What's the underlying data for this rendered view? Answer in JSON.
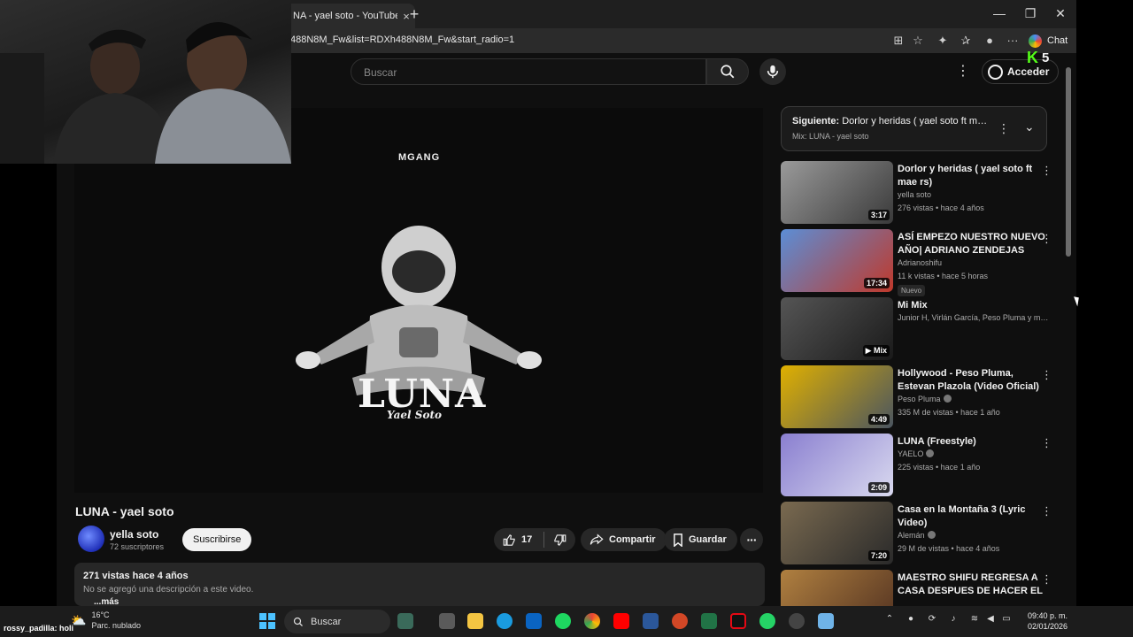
{
  "browser": {
    "tab_title": "NA - yael soto - YouTube",
    "tab_close": "×",
    "new_tab": "+",
    "url": "488N8M_Fw&list=RDXh488N8M_Fw&start_radio=1",
    "chat_label": "Chat",
    "win_minimize": "—",
    "win_maximize": "❐",
    "win_close": "✕"
  },
  "masthead": {
    "search_placeholder": "Buscar",
    "signin_label": "Acceder"
  },
  "video": {
    "brand": "MGANG",
    "art_title": "LUNA",
    "art_subtitle": "Yael Soto",
    "title": "LUNA - yael soto",
    "channel": "yella  soto",
    "subscribers": "72 suscriptores",
    "subscribe_label": "Suscribirse",
    "likes": "17",
    "share_label": "Compartir",
    "save_label": "Guardar",
    "more_label": "···",
    "stats": "271 vistas  hace 4 años",
    "description": "No se agregó una descripción a este video.",
    "more_text": "...más"
  },
  "mix": {
    "next_prefix": "Siguiente:",
    "next_title": "Dorlor y heridas ( yael soto ft mae ...",
    "subtitle": "Mix: LUNA - yael soto"
  },
  "playlist": [
    {
      "title": "Dorlor y heridas ( yael soto ft mae rs)",
      "channel": "yella soto",
      "meta": "276 vistas • hace 4 años",
      "duration": "3:17",
      "thumb_colors": [
        "#9a9a9a",
        "#3a3a3a"
      ],
      "verified": false,
      "badge": ""
    },
    {
      "title": "ASÍ EMPEZO NUESTRO NUEVO AÑO| ADRIANO ZENDEJAS",
      "channel": "Adrianoshifu",
      "meta": "11 k vistas • hace 5 horas",
      "duration": "17:34",
      "thumb_colors": [
        "#5b8ed6",
        "#c0392b"
      ],
      "verified": false,
      "badge": "Nuevo"
    },
    {
      "title": "Mi Mix",
      "channel": "Junior H, Virlán García, Peso Pluma y mu...",
      "meta": "",
      "duration": "▶ Mix",
      "thumb_colors": [
        "#555555",
        "#1a1a1a"
      ],
      "verified": false,
      "badge": ""
    },
    {
      "title": "Hollywood - Peso Pluma, Estevan Plazola (Video Oficial)",
      "channel": "Peso Pluma",
      "meta": "335 M de vistas • hace 1 año",
      "duration": "4:49",
      "thumb_colors": [
        "#e0b000",
        "#4a5560"
      ],
      "verified": true,
      "badge": ""
    },
    {
      "title": "LUNA (Freestyle)",
      "channel": "YAELO",
      "meta": "225 vistas • hace 1 año",
      "duration": "2:09",
      "thumb_colors": [
        "#8a7fd0",
        "#d9d9ef"
      ],
      "verified": true,
      "badge": ""
    },
    {
      "title": "Casa en la Montaña 3 (Lyric Video)",
      "channel": "Alemán",
      "meta": "29 M de vistas • hace 4 años",
      "duration": "7:20",
      "thumb_colors": [
        "#7a6a50",
        "#2a2a2a"
      ],
      "verified": true,
      "badge": ""
    },
    {
      "title": "MAESTRO SHIFU REGRESA A CASA DESPUES DE HACER EL ...",
      "channel": "",
      "meta": "",
      "duration": "",
      "thumb_colors": [
        "#b08040",
        "#503020"
      ],
      "verified": false,
      "badge": ""
    }
  ],
  "overlay": {
    "kick_number": "5",
    "chat_user": "rossy_padilla",
    "chat_message": ": holi"
  },
  "taskbar": {
    "temperature": "16°C",
    "weather": "Parc. nublado",
    "search_label": "Buscar",
    "time": "09:40 p. m.",
    "date": "02/01/2026"
  }
}
